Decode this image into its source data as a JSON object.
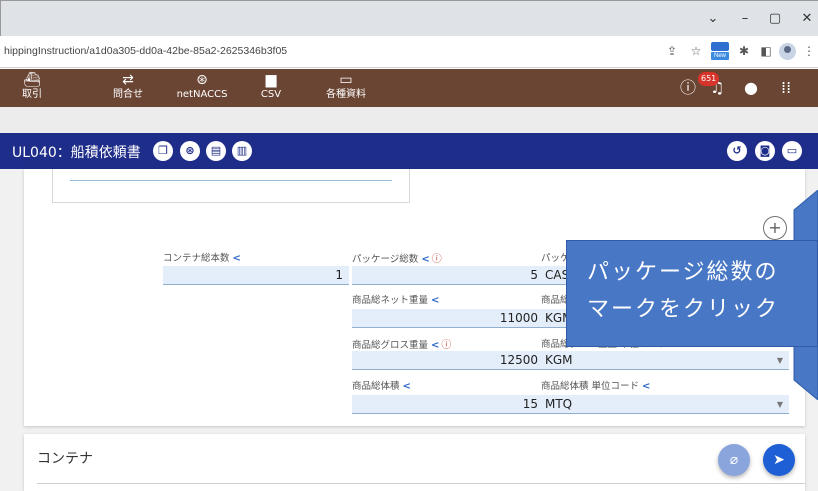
{
  "browser": {
    "window_controls": {
      "dropdown": "⌄",
      "minimize": "–",
      "maximize": "▢",
      "close": "✕"
    },
    "url": "hippingInstruction/a1d0a305-dd0a-42be-85a2-2625346b3f05",
    "extension_new_badge": "New"
  },
  "nav": {
    "items": [
      {
        "icon": "ship-icon",
        "label": "取引"
      },
      {
        "icon": "arrows-icon",
        "label": "問合せ"
      },
      {
        "icon": "globe-icon",
        "label": "netNACCS"
      },
      {
        "icon": "file-icon",
        "label": "CSV"
      },
      {
        "icon": "folder-icon",
        "label": "各種資料"
      }
    ],
    "notification_count": "651"
  },
  "screen": {
    "title": "UL040：船積依頼書"
  },
  "fields": {
    "container_total": {
      "label": "コンテナ総本数",
      "value": "1"
    },
    "package_total": {
      "label": "パッケージ総数",
      "value": "5"
    },
    "package_unit": {
      "label": "パッケ",
      "value": "CASE"
    },
    "net_weight": {
      "label": "商品総ネット重量",
      "value": "11000"
    },
    "net_weight_unit": {
      "label": "商品総",
      "value": "KGM"
    },
    "gross_weight": {
      "label": "商品総グロス重量",
      "value": "12500"
    },
    "gross_weight_unit": {
      "label": "商品総グロス重量 単位コード",
      "value": "KGM"
    },
    "volume": {
      "label": "商品総体積",
      "value": "15"
    },
    "volume_unit": {
      "label": "商品総体積 単位コード",
      "value": "MTQ"
    }
  },
  "callout": {
    "line1": "パッケージ総数の",
    "line2": "マークをクリック"
  },
  "container_section": {
    "title": "コンテナ"
  },
  "colors": {
    "nav_bg": "#6a4534",
    "toolbar_bg": "#1f2d8a",
    "callout_bg": "#4877c5",
    "field_bg": "#e3eefa",
    "share_icon": "#2f68c8",
    "badge": "#d6342b"
  }
}
